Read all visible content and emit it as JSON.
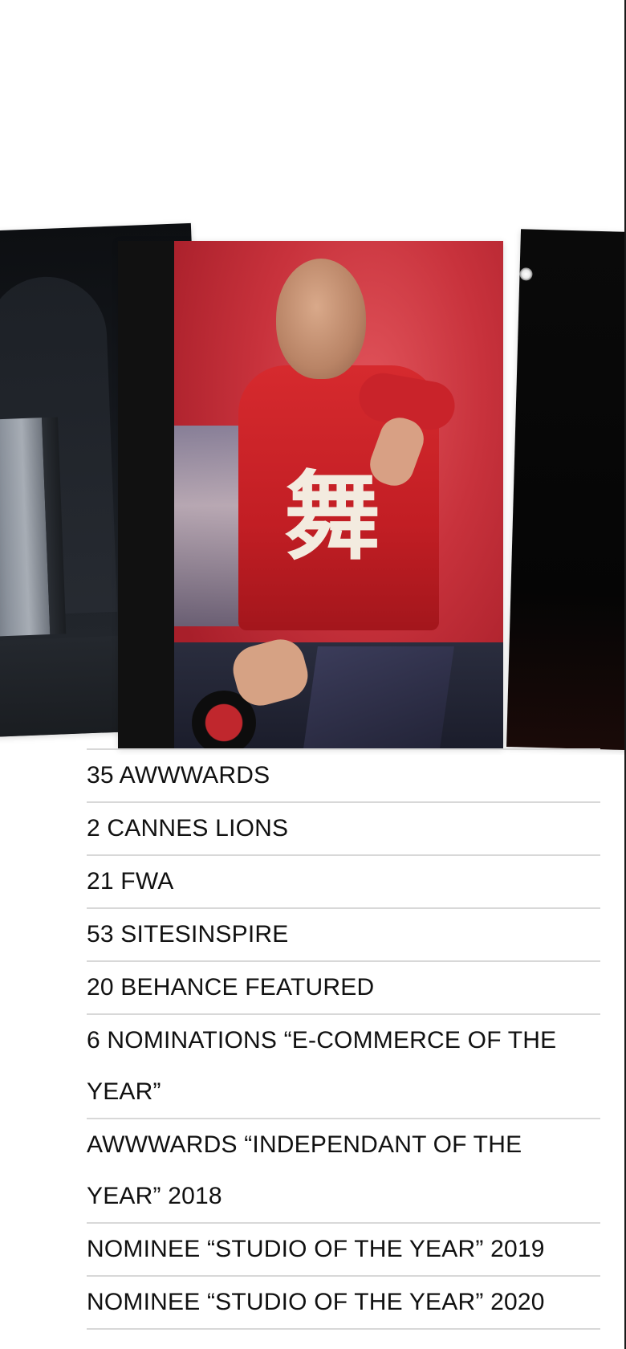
{
  "gallery": {
    "cards": [
      {
        "name": "studio-object-image"
      },
      {
        "name": "dj-portrait-image",
        "glyph": "舞"
      },
      {
        "name": "dark-stage-image"
      }
    ]
  },
  "awards": [
    {
      "label": "35 AWWWARDS"
    },
    {
      "label": "2 CANNES LIONS"
    },
    {
      "label": "21 FWA"
    },
    {
      "label": "53 SITESINSPIRE"
    },
    {
      "label": "20 BEHANCE FEATURED"
    },
    {
      "label": "6 NOMINATIONS “E-COMMERCE OF THE YEAR”"
    },
    {
      "label": "AWWWARDS “INDEPENDANT OF THE YEAR” 2018"
    },
    {
      "label": "NOMINEE “STUDIO OF THE YEAR” 2019"
    },
    {
      "label": "NOMINEE “STUDIO OF THE YEAR” 2020"
    }
  ],
  "colors": {
    "text": "#111111",
    "divider": "#d8d8d8",
    "background": "#ffffff"
  }
}
